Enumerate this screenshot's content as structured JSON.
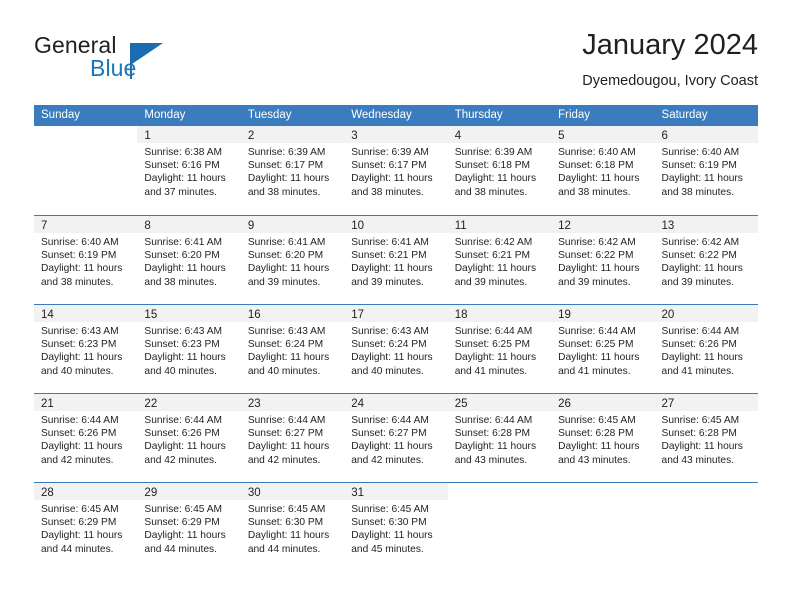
{
  "brand": {
    "name_part1": "General",
    "name_part2": "Blue",
    "logo_icon": "blue-triangle-flag-icon"
  },
  "header": {
    "title": "January 2024",
    "subtitle": "Dyemedougou, Ivory Coast"
  },
  "colors": {
    "header_blue": "#3a7cbe",
    "brand_blue": "#1b75bb",
    "daynum_band": "#f2f2f2",
    "text": "#231f20"
  },
  "calendar": {
    "weekday_headers": [
      "Sunday",
      "Monday",
      "Tuesday",
      "Wednesday",
      "Thursday",
      "Friday",
      "Saturday"
    ],
    "weeks": [
      [
        {
          "day": "",
          "empty": true
        },
        {
          "day": "1",
          "sunrise": "Sunrise: 6:38 AM",
          "sunset": "Sunset: 6:16 PM",
          "daylight": "Daylight: 11 hours and 37 minutes."
        },
        {
          "day": "2",
          "sunrise": "Sunrise: 6:39 AM",
          "sunset": "Sunset: 6:17 PM",
          "daylight": "Daylight: 11 hours and 38 minutes."
        },
        {
          "day": "3",
          "sunrise": "Sunrise: 6:39 AM",
          "sunset": "Sunset: 6:17 PM",
          "daylight": "Daylight: 11 hours and 38 minutes."
        },
        {
          "day": "4",
          "sunrise": "Sunrise: 6:39 AM",
          "sunset": "Sunset: 6:18 PM",
          "daylight": "Daylight: 11 hours and 38 minutes."
        },
        {
          "day": "5",
          "sunrise": "Sunrise: 6:40 AM",
          "sunset": "Sunset: 6:18 PM",
          "daylight": "Daylight: 11 hours and 38 minutes."
        },
        {
          "day": "6",
          "sunrise": "Sunrise: 6:40 AM",
          "sunset": "Sunset: 6:19 PM",
          "daylight": "Daylight: 11 hours and 38 minutes."
        }
      ],
      [
        {
          "day": "7",
          "sunrise": "Sunrise: 6:40 AM",
          "sunset": "Sunset: 6:19 PM",
          "daylight": "Daylight: 11 hours and 38 minutes."
        },
        {
          "day": "8",
          "sunrise": "Sunrise: 6:41 AM",
          "sunset": "Sunset: 6:20 PM",
          "daylight": "Daylight: 11 hours and 38 minutes."
        },
        {
          "day": "9",
          "sunrise": "Sunrise: 6:41 AM",
          "sunset": "Sunset: 6:20 PM",
          "daylight": "Daylight: 11 hours and 39 minutes."
        },
        {
          "day": "10",
          "sunrise": "Sunrise: 6:41 AM",
          "sunset": "Sunset: 6:21 PM",
          "daylight": "Daylight: 11 hours and 39 minutes."
        },
        {
          "day": "11",
          "sunrise": "Sunrise: 6:42 AM",
          "sunset": "Sunset: 6:21 PM",
          "daylight": "Daylight: 11 hours and 39 minutes."
        },
        {
          "day": "12",
          "sunrise": "Sunrise: 6:42 AM",
          "sunset": "Sunset: 6:22 PM",
          "daylight": "Daylight: 11 hours and 39 minutes."
        },
        {
          "day": "13",
          "sunrise": "Sunrise: 6:42 AM",
          "sunset": "Sunset: 6:22 PM",
          "daylight": "Daylight: 11 hours and 39 minutes."
        }
      ],
      [
        {
          "day": "14",
          "sunrise": "Sunrise: 6:43 AM",
          "sunset": "Sunset: 6:23 PM",
          "daylight": "Daylight: 11 hours and 40 minutes."
        },
        {
          "day": "15",
          "sunrise": "Sunrise: 6:43 AM",
          "sunset": "Sunset: 6:23 PM",
          "daylight": "Daylight: 11 hours and 40 minutes."
        },
        {
          "day": "16",
          "sunrise": "Sunrise: 6:43 AM",
          "sunset": "Sunset: 6:24 PM",
          "daylight": "Daylight: 11 hours and 40 minutes."
        },
        {
          "day": "17",
          "sunrise": "Sunrise: 6:43 AM",
          "sunset": "Sunset: 6:24 PM",
          "daylight": "Daylight: 11 hours and 40 minutes."
        },
        {
          "day": "18",
          "sunrise": "Sunrise: 6:44 AM",
          "sunset": "Sunset: 6:25 PM",
          "daylight": "Daylight: 11 hours and 41 minutes."
        },
        {
          "day": "19",
          "sunrise": "Sunrise: 6:44 AM",
          "sunset": "Sunset: 6:25 PM",
          "daylight": "Daylight: 11 hours and 41 minutes."
        },
        {
          "day": "20",
          "sunrise": "Sunrise: 6:44 AM",
          "sunset": "Sunset: 6:26 PM",
          "daylight": "Daylight: 11 hours and 41 minutes."
        }
      ],
      [
        {
          "day": "21",
          "sunrise": "Sunrise: 6:44 AM",
          "sunset": "Sunset: 6:26 PM",
          "daylight": "Daylight: 11 hours and 42 minutes."
        },
        {
          "day": "22",
          "sunrise": "Sunrise: 6:44 AM",
          "sunset": "Sunset: 6:26 PM",
          "daylight": "Daylight: 11 hours and 42 minutes."
        },
        {
          "day": "23",
          "sunrise": "Sunrise: 6:44 AM",
          "sunset": "Sunset: 6:27 PM",
          "daylight": "Daylight: 11 hours and 42 minutes."
        },
        {
          "day": "24",
          "sunrise": "Sunrise: 6:44 AM",
          "sunset": "Sunset: 6:27 PM",
          "daylight": "Daylight: 11 hours and 42 minutes."
        },
        {
          "day": "25",
          "sunrise": "Sunrise: 6:44 AM",
          "sunset": "Sunset: 6:28 PM",
          "daylight": "Daylight: 11 hours and 43 minutes."
        },
        {
          "day": "26",
          "sunrise": "Sunrise: 6:45 AM",
          "sunset": "Sunset: 6:28 PM",
          "daylight": "Daylight: 11 hours and 43 minutes."
        },
        {
          "day": "27",
          "sunrise": "Sunrise: 6:45 AM",
          "sunset": "Sunset: 6:28 PM",
          "daylight": "Daylight: 11 hours and 43 minutes."
        }
      ],
      [
        {
          "day": "28",
          "sunrise": "Sunrise: 6:45 AM",
          "sunset": "Sunset: 6:29 PM",
          "daylight": "Daylight: 11 hours and 44 minutes."
        },
        {
          "day": "29",
          "sunrise": "Sunrise: 6:45 AM",
          "sunset": "Sunset: 6:29 PM",
          "daylight": "Daylight: 11 hours and 44 minutes."
        },
        {
          "day": "30",
          "sunrise": "Sunrise: 6:45 AM",
          "sunset": "Sunset: 6:30 PM",
          "daylight": "Daylight: 11 hours and 44 minutes."
        },
        {
          "day": "31",
          "sunrise": "Sunrise: 6:45 AM",
          "sunset": "Sunset: 6:30 PM",
          "daylight": "Daylight: 11 hours and 45 minutes."
        },
        {
          "day": "",
          "empty": true
        },
        {
          "day": "",
          "empty": true
        },
        {
          "day": "",
          "empty": true
        }
      ]
    ]
  }
}
